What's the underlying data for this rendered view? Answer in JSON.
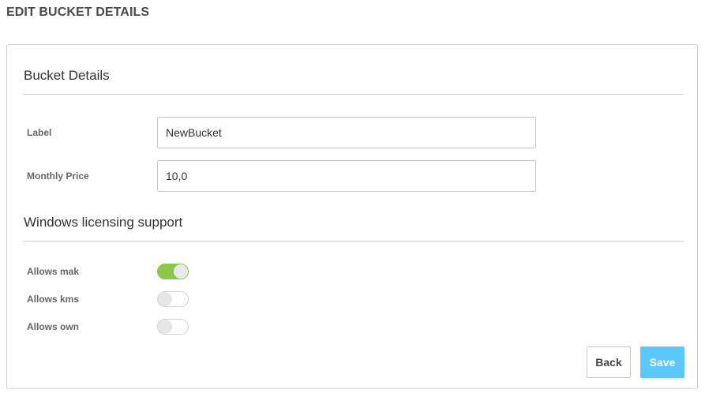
{
  "page": {
    "title": "EDIT BUCKET DETAILS"
  },
  "bucket_details": {
    "heading": "Bucket Details",
    "label": {
      "label": "Label",
      "value": "NewBucket"
    },
    "monthly_price": {
      "label": "Monthly Price",
      "value": "10,0"
    }
  },
  "licensing": {
    "heading": "Windows licensing support",
    "options": [
      {
        "label": "Allows mak",
        "enabled": true
      },
      {
        "label": "Allows kms",
        "enabled": false
      },
      {
        "label": "Allows own",
        "enabled": false
      }
    ]
  },
  "actions": {
    "back_label": "Back",
    "save_label": "Save"
  },
  "colors": {
    "toggle_on": "#8dc74a",
    "save_button": "#5ac8fa"
  }
}
